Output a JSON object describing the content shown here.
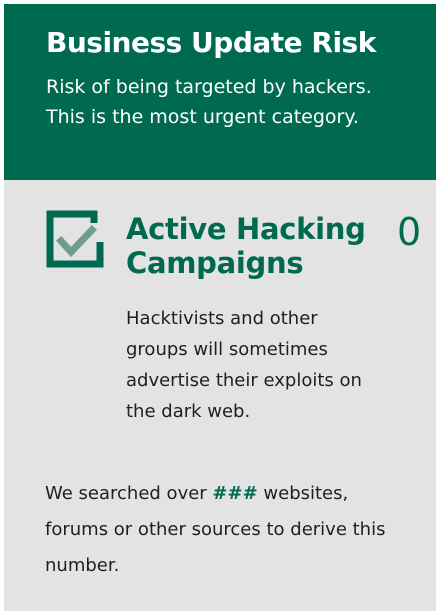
{
  "header": {
    "title": "Business Update Risk",
    "description": "Risk of being targeted by hackers. This is the most urgent category."
  },
  "metric": {
    "icon": "check-box-icon",
    "title": "Active Hacking Campaigns",
    "count": "0",
    "description": "Hacktivists and other groups will sometimes advertise their exploits on the dark web."
  },
  "footnote": {
    "prefix": "We searched over ",
    "emphasis": "###",
    "suffix": " websites, forums or other sources to derive this number."
  },
  "colors": {
    "brand_green": "#006a51",
    "check_mark": "#6e9e8b",
    "panel_bg": "#e3e3e3"
  }
}
